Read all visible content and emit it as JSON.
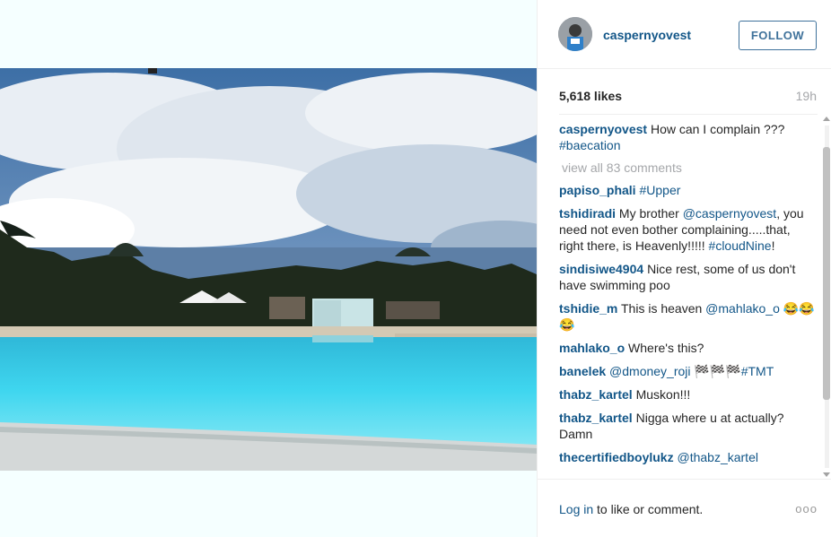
{
  "post": {
    "username": "caspernyovest",
    "follow_label": "FOLLOW",
    "likes": "5,618 likes",
    "time": "19h"
  },
  "comments": {
    "caption_user": "caspernyovest",
    "caption_text": "How can I complain ???",
    "caption_tag": "#baecation",
    "view_all": "view all 83 comments",
    "c1_user": "papiso_phali",
    "c1_tag": "#Upper",
    "c2_user": "tshidiradi",
    "c2_text1": "My brother",
    "c2_mention": "@caspernyovest",
    "c2_text2": ", you need not even bother complaining.....that, right there, is Heavenly!!!!!",
    "c2_tag": "#cloudNine",
    "c2_text3": "!",
    "c3_user": "sindisiwe4904",
    "c3_text": "Nice rest, some of us don't have swimming poo",
    "c4_user": "tshidie_m",
    "c4_text": "This is heaven",
    "c4_mention": "@mahlako_o",
    "c4_emoji": "😂😂😂",
    "c5_user": "mahlako_o",
    "c5_text": "Where's this?",
    "c6_user": "banelek",
    "c6_mention": "@dmoney_roji",
    "c6_emoji": "🏁🏁🏁",
    "c6_tag": "#TMT",
    "c7_user": "thabz_kartel",
    "c7_text": "Muskon!!!",
    "c8_user": "thabz_kartel",
    "c8_text": "Nigga where u at actually? Damn",
    "c9_user": "thecertifiedboylukz",
    "c9_mention": "@thabz_kartel"
  },
  "footer": {
    "login_link": "Log in",
    "login_text": "to like or comment.",
    "more": "ooo"
  },
  "colors": {
    "link": "#125688",
    "follow": "#3f729b",
    "muted": "#a5a7aa",
    "text": "#262626"
  }
}
